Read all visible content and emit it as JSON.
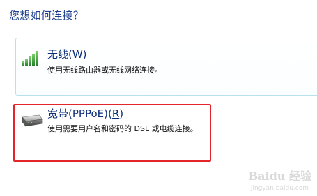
{
  "question": "您想如何连接？",
  "options": [
    {
      "id": "wireless",
      "title": "无线(W)",
      "description": "使用无线路由器或无线网络连接。",
      "icon": "wireless-signal-icon"
    },
    {
      "id": "broadband",
      "title_main": "宽带(PPPoE)(",
      "title_key": "R",
      "title_end": ")",
      "description": "使用需要用户名和密码的 DSL 或电缆连接。",
      "icon": "broadband-modem-icon"
    }
  ],
  "watermark": {
    "text": "Baidu 经验",
    "sub": "jingyan.baidu.com"
  },
  "colors": {
    "question": "#1e3f8f",
    "title": "#0d2f7a",
    "wireless_border": "#b9e0ef",
    "highlight": "#e3262b",
    "signal_green": "#3aa53a"
  }
}
